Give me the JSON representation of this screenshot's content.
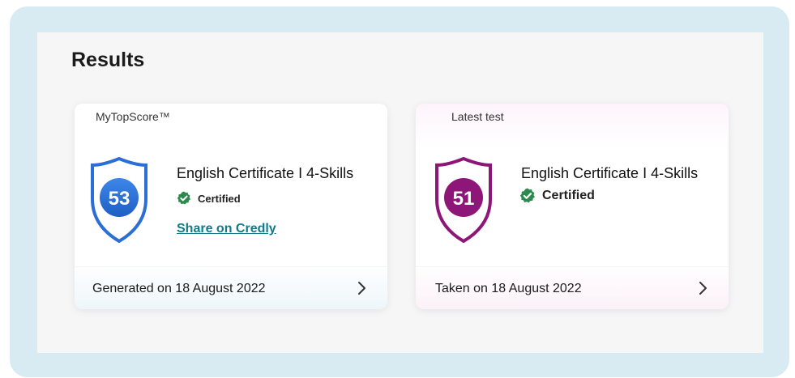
{
  "section": {
    "title": "Results"
  },
  "cards": [
    {
      "tag": "MyTopScore™",
      "score": "53",
      "shield_color": "#2b6fd6",
      "certificate": "English Certificate I 4-Skills",
      "status": "Certified",
      "share_link": "Share on Credly",
      "footer": "Generated on 18 August 2022"
    },
    {
      "tag": "Latest test",
      "score": "51",
      "shield_color": "#8e1678",
      "certificate": "English Certificate I 4-Skills",
      "status": "Certified",
      "footer": "Taken on 18 August 2022"
    }
  ],
  "colors": {
    "frame": "#d8eaf2",
    "certified_check": "#2c8a4e",
    "link": "#117a8b"
  },
  "icons": [
    "shield-score-icon",
    "certified-check-icon",
    "chevron-right-icon"
  ]
}
